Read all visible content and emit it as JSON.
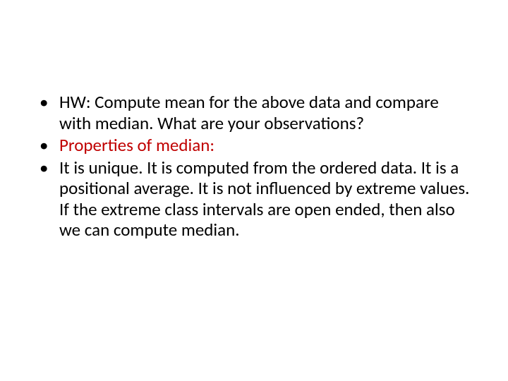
{
  "slide": {
    "bullets": [
      {
        "text": "HW: Compute mean for the above data and compare with median. What are your observations?",
        "color": "black"
      },
      {
        "text": "Properties of median:",
        "color": "red"
      },
      {
        "text": "It is unique. It is computed from the ordered data. It is a positional average. It is not influenced by extreme values. If the extreme class intervals are open ended, then also we can compute median.",
        "color": "black"
      }
    ]
  }
}
